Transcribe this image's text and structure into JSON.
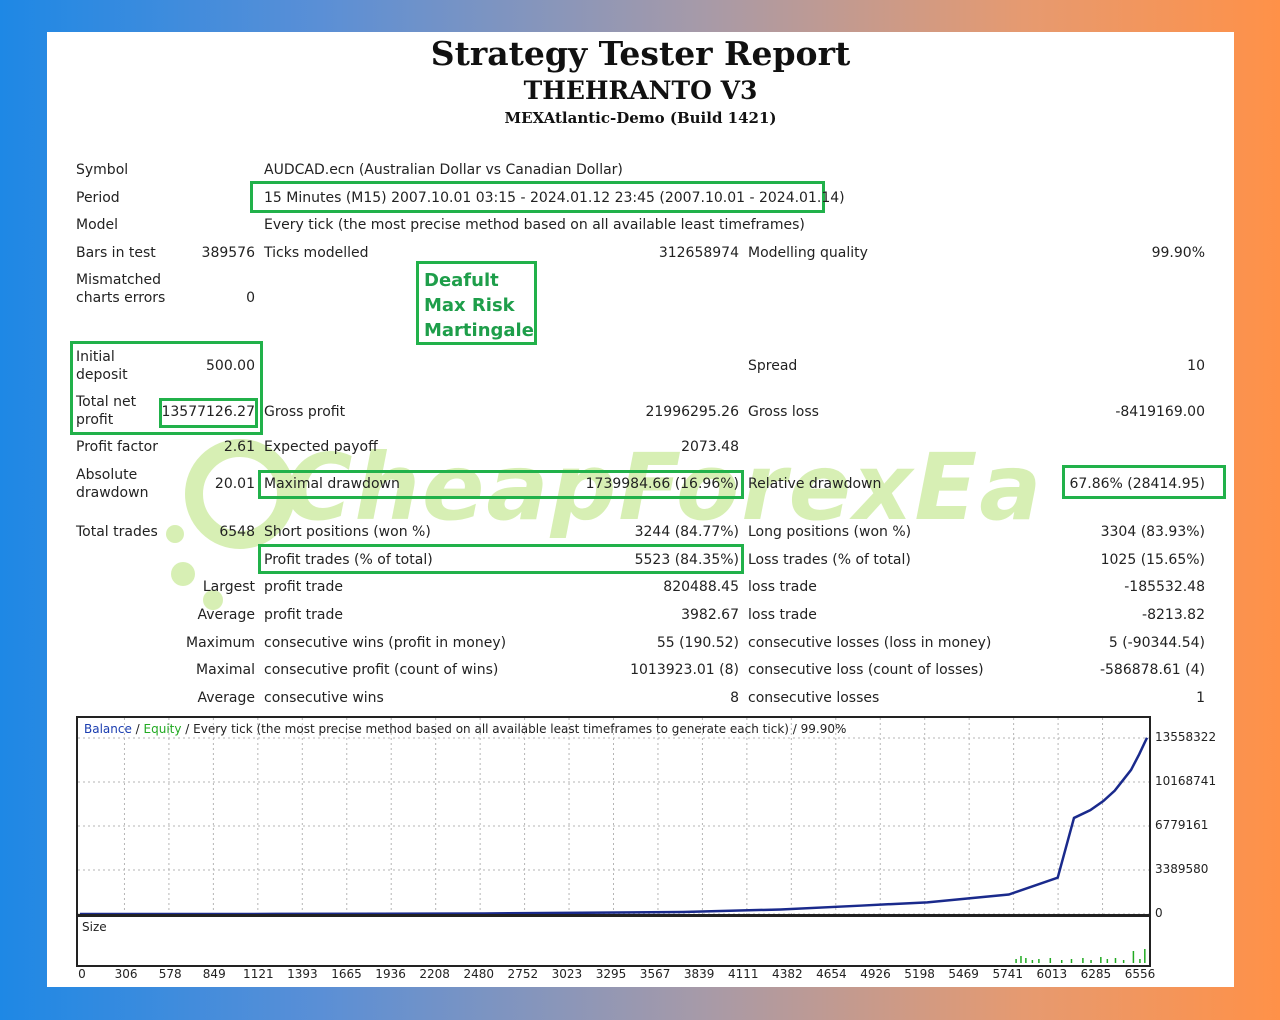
{
  "header": {
    "title": "Strategy Tester Report",
    "ea_name": "THEHRANTO V3",
    "server": "MEXAtlantic-Demo (Build 1421)"
  },
  "info": {
    "symbol_label": "Symbol",
    "symbol_value": "AUDCAD.ecn (Australian Dollar vs Canadian Dollar)",
    "period_label": "Period",
    "period_value": "15 Minutes (M15) 2007.10.01 03:15 - 2024.01.12 23:45 (2007.10.01 - 2024.01.14)",
    "model_label": "Model",
    "model_value": "Every tick (the most precise method based on all available least timeframes)",
    "bars_label": "Bars in test",
    "bars_value": "389576",
    "ticks_label": "Ticks modelled",
    "ticks_value": "312658974",
    "quality_label": "Modelling quality",
    "quality_value": "99.90%",
    "mismatched_label": "Mismatched charts errors",
    "mismatched_value": "0"
  },
  "notes": [
    "Deafult",
    "Max Risk",
    "Martingale"
  ],
  "results": {
    "initial_deposit_label": "Initial deposit",
    "initial_deposit_value": "500.00",
    "spread_label": "Spread",
    "spread_value": "10",
    "net_profit_label": "Total net profit",
    "net_profit_value": "13577126.27",
    "gross_profit_label": "Gross profit",
    "gross_profit_value": "21996295.26",
    "gross_loss_label": "Gross loss",
    "gross_loss_value": "-8419169.00",
    "profit_factor_label": "Profit factor",
    "profit_factor_value": "2.61",
    "expected_payoff_label": "Expected payoff",
    "expected_payoff_value": "2073.48",
    "abs_drawdown_label": "Absolute drawdown",
    "abs_drawdown_value": "20.01",
    "max_drawdown_label": "Maximal drawdown",
    "max_drawdown_value": "1739984.66 (16.96%)",
    "rel_drawdown_label": "Relative drawdown",
    "rel_drawdown_value": "67.86% (28414.95)",
    "total_trades_label": "Total trades",
    "total_trades_value": "6548",
    "short_label": "Short positions (won %)",
    "short_value": "3244 (84.77%)",
    "long_label": "Long positions (won %)",
    "long_value": "3304 (83.93%)",
    "profit_trades_label": "Profit trades (% of total)",
    "profit_trades_value": "5523 (84.35%)",
    "loss_trades_label": "Loss trades (% of total)",
    "loss_trades_value": "1025 (15.65%)"
  },
  "stats": [
    {
      "prefix": "Largest",
      "label1": "profit trade",
      "value1": "820488.45",
      "label2": "loss trade",
      "value2": "-185532.48"
    },
    {
      "prefix": "Average",
      "label1": "profit trade",
      "value1": "3982.67",
      "label2": "loss trade",
      "value2": "-8213.82"
    },
    {
      "prefix": "Maximum",
      "label1": "consecutive wins (profit in money)",
      "value1": "55 (190.52)",
      "label2": "consecutive losses (loss in money)",
      "value2": "5 (-90344.54)"
    },
    {
      "prefix": "Maximal",
      "label1": "consecutive profit (count of wins)",
      "value1": "1013923.01 (8)",
      "label2": "consecutive loss (count of losses)",
      "value2": "-586878.61 (4)"
    },
    {
      "prefix": "Average",
      "label1": "consecutive wins",
      "value1": "8",
      "label2": "consecutive losses",
      "value2": "1"
    }
  ],
  "watermark": "CheapForexEa",
  "chart_data": {
    "type": "line",
    "legend_balance": "Balance",
    "legend_sep1": " / ",
    "legend_equity": "Equity",
    "legend_rest": " / Every tick (the most precise method based on all available least timeframes to generate each tick) / 99.90%",
    "size_label": "Size",
    "ylim": [
      0,
      13558322
    ],
    "yticks": [
      "13558322",
      "10168741",
      "6779161",
      "3389580",
      "0"
    ],
    "xticks": [
      "0",
      "306",
      "578",
      "849",
      "1121",
      "1393",
      "1665",
      "1936",
      "2208",
      "2480",
      "2752",
      "3023",
      "3295",
      "3567",
      "3839",
      "4111",
      "4382",
      "4654",
      "4926",
      "5198",
      "5469",
      "5741",
      "6013",
      "6285",
      "6556"
    ],
    "series": [
      {
        "name": "Balance",
        "color": "#1a2a8c",
        "x": [
          0,
          1200,
          2480,
          3700,
          4300,
          4800,
          5200,
          5700,
          6000,
          6100,
          6200,
          6280,
          6350,
          6400,
          6450,
          6500,
          6548
        ],
        "y": [
          500,
          5000,
          40000,
          150000,
          350000,
          650000,
          900000,
          1500000,
          2800000,
          7400000,
          8000000,
          8700000,
          9500000,
          10300000,
          11100000,
          12300000,
          13577126
        ]
      }
    ]
  }
}
